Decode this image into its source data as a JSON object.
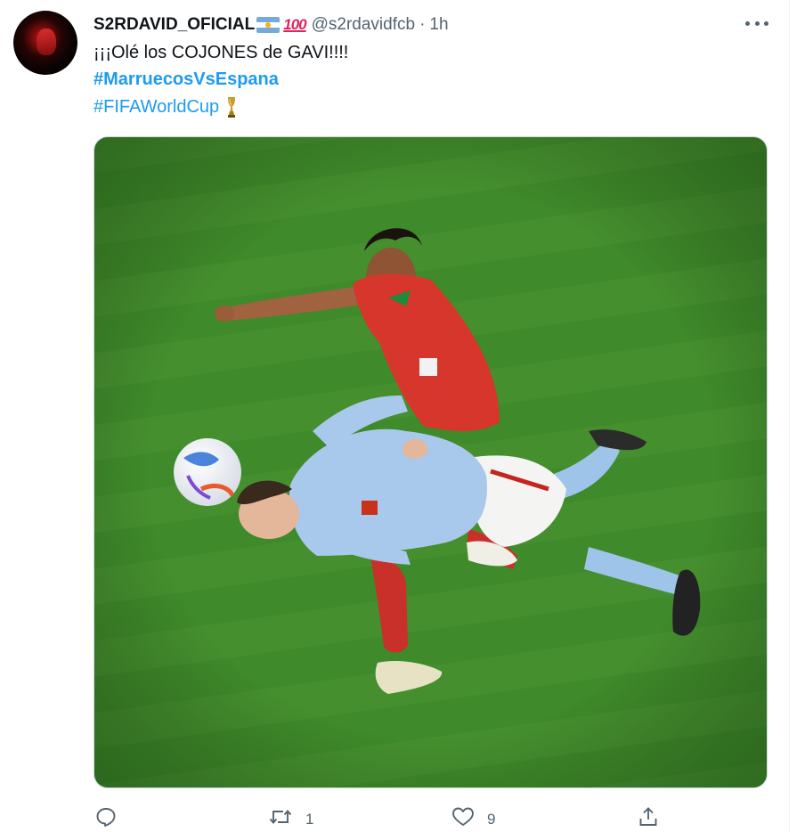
{
  "tweet": {
    "display_name": "S2RDAVID_OFICIAL",
    "handle": "@s2rdavidfcb",
    "separator": "·",
    "time": "1h",
    "badges": [
      "argentina-flag-icon",
      "hundred-points-icon"
    ],
    "hundred_emoji_text": "100",
    "text_line1": "¡¡¡Olé los COJONES de GAVI!!!!",
    "hashtag1": "#MarruecosVsEspana",
    "hashtag2": "#FIFAWorldCup",
    "hashtag2_icon": "trophy-icon",
    "media_alt": "Soccer photo: Spain player heading the ball while falling, Morocco player behind on green pitch"
  },
  "actions": {
    "reply_icon": "reply-icon",
    "reply_count": "",
    "retweet_icon": "retweet-icon",
    "retweet_count": "1",
    "like_icon": "heart-icon",
    "like_count": "9",
    "share_icon": "share-icon"
  },
  "colors": {
    "link": "#1d9bf0",
    "secondary_text": "#536471",
    "primary_text": "#0f1419",
    "pitch_green": "#3f8a2a"
  }
}
